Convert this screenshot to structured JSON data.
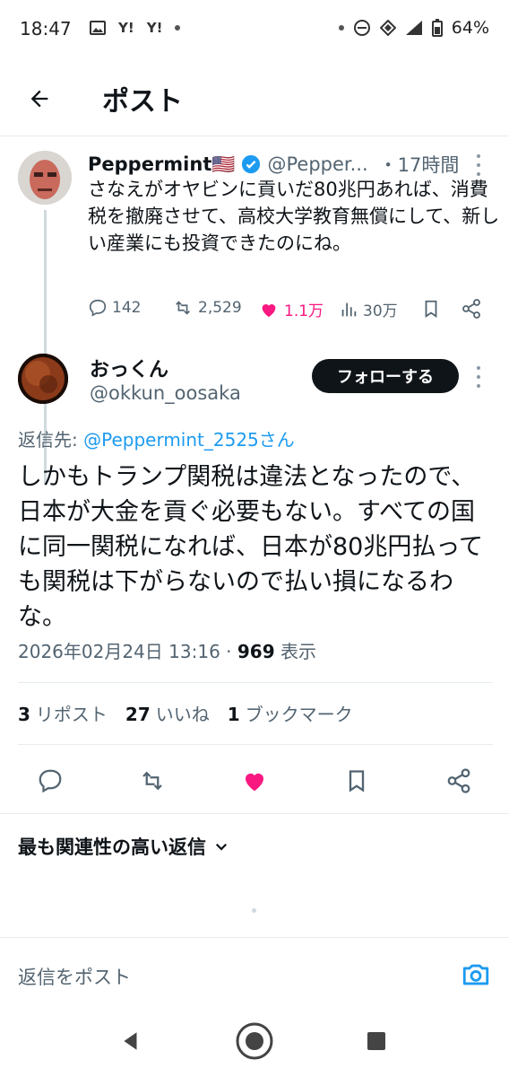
{
  "status_bar": {
    "time": "18:47",
    "battery": "64%",
    "left_icons": [
      "image-icon",
      "yahoo-icon",
      "yahoo-icon",
      "dot-icon"
    ],
    "yahoo_label": "Y!"
  },
  "header": {
    "title": "ポスト"
  },
  "parent_tweet": {
    "display_name": "Peppermint🇺🇸",
    "handle": "@Pepper...",
    "time": "・17時間",
    "text": "さなえがオヤビンに貢いだ80兆円あれば、消費税を撤廃させて、高校大学教育無償にして、新しい産業にも投資できたのにね。",
    "replies": "142",
    "reposts": "2,529",
    "likes": "1.1万",
    "views": "30万"
  },
  "main_tweet": {
    "display_name": "おっくん",
    "handle": "@okkun_oosaka",
    "follow_label": "フォローする",
    "reply_to_label": "返信先: ",
    "reply_to_mention": "@Peppermint_2525さん",
    "text": "しかもトランプ関税は違法となったので、日本が大金を貢ぐ必要もない。すべての国に同一関税になれば、日本が80兆円払っても関税は下がらないので払い損になるわな。",
    "timestamp": "2026年02月24日 13:16 · ",
    "views_count": "969",
    "views_label": " 表示",
    "stats": {
      "reposts_count": "3",
      "reposts_label": "リポスト",
      "likes_count": "27",
      "likes_label": "いいね",
      "bookmarks_count": "1",
      "bookmarks_label": "ブックマーク"
    }
  },
  "replies_section": {
    "sort_label": "最も関連性の高い返信"
  },
  "reply_box": {
    "placeholder": "返信をポスト"
  },
  "colors": {
    "accent": "#1d9bf0",
    "like": "#f91880",
    "text": "#0f1419",
    "secondary": "#536471"
  }
}
